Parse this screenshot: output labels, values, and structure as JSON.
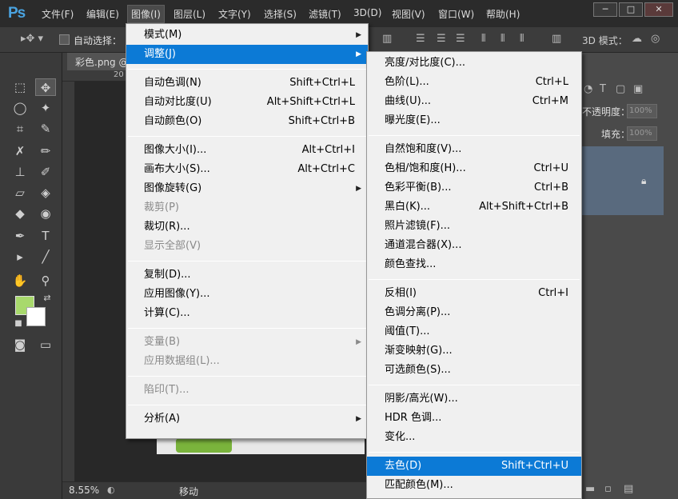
{
  "app": {
    "logo": "Ps"
  },
  "menubar": {
    "items": [
      "文件(F)",
      "编辑(E)",
      "图像(I)",
      "图层(L)",
      "文字(Y)",
      "选择(S)",
      "滤镜(T)",
      "3D(D)",
      "视图(V)",
      "窗口(W)",
      "帮助(H)"
    ],
    "active": "图像(I)"
  },
  "window_controls": {
    "minimize": "─",
    "restore": "□",
    "close": "✕"
  },
  "options_bar": {
    "auto_select_label": "自动选择：",
    "mode_3d_label": "3D 模式："
  },
  "document": {
    "tab_label": "彩色.png @",
    "ruler_top_label": "20",
    "ruler_left_labels": [
      "0",
      "2",
      "4",
      "6",
      "8",
      "1",
      "1",
      "1",
      "1",
      "1",
      "2"
    ],
    "zoom": "8.55%",
    "status": "移动"
  },
  "right_panel": {
    "opacity_label": "不透明度：",
    "opacity_value": "100%",
    "fill_label": "填充：",
    "fill_value": "100%"
  },
  "colors": {
    "foreground": "#a8d96c",
    "background": "#ffffff",
    "menu_highlight": "#0c7ad6"
  },
  "image_menu": {
    "items": [
      {
        "label": "模式(M)",
        "shortcut": "",
        "submenu": true,
        "disabled": false,
        "highlight": false
      },
      {
        "label": "调整(J)",
        "shortcut": "",
        "submenu": true,
        "disabled": false,
        "highlight": true
      },
      {
        "sep": true
      },
      {
        "label": "自动色调(N)",
        "shortcut": "Shift+Ctrl+L",
        "submenu": false,
        "disabled": false,
        "highlight": false
      },
      {
        "label": "自动对比度(U)",
        "shortcut": "Alt+Shift+Ctrl+L",
        "submenu": false,
        "disabled": false,
        "highlight": false
      },
      {
        "label": "自动颜色(O)",
        "shortcut": "Shift+Ctrl+B",
        "submenu": false,
        "disabled": false,
        "highlight": false
      },
      {
        "sep": true
      },
      {
        "label": "图像大小(I)...",
        "shortcut": "Alt+Ctrl+I",
        "submenu": false,
        "disabled": false,
        "highlight": false
      },
      {
        "label": "画布大小(S)...",
        "shortcut": "Alt+Ctrl+C",
        "submenu": false,
        "disabled": false,
        "highlight": false
      },
      {
        "label": "图像旋转(G)",
        "shortcut": "",
        "submenu": true,
        "disabled": false,
        "highlight": false
      },
      {
        "label": "裁剪(P)",
        "shortcut": "",
        "submenu": false,
        "disabled": true,
        "highlight": false
      },
      {
        "label": "裁切(R)...",
        "shortcut": "",
        "submenu": false,
        "disabled": false,
        "highlight": false
      },
      {
        "label": "显示全部(V)",
        "shortcut": "",
        "submenu": false,
        "disabled": true,
        "highlight": false
      },
      {
        "sep": true
      },
      {
        "label": "复制(D)...",
        "shortcut": "",
        "submenu": false,
        "disabled": false,
        "highlight": false
      },
      {
        "label": "应用图像(Y)...",
        "shortcut": "",
        "submenu": false,
        "disabled": false,
        "highlight": false
      },
      {
        "label": "计算(C)...",
        "shortcut": "",
        "submenu": false,
        "disabled": false,
        "highlight": false
      },
      {
        "sep": true
      },
      {
        "label": "变量(B)",
        "shortcut": "",
        "submenu": true,
        "disabled": true,
        "highlight": false
      },
      {
        "label": "应用数据组(L)...",
        "shortcut": "",
        "submenu": false,
        "disabled": true,
        "highlight": false
      },
      {
        "sep": true
      },
      {
        "label": "陷印(T)...",
        "shortcut": "",
        "submenu": false,
        "disabled": true,
        "highlight": false
      },
      {
        "sep": true
      },
      {
        "label": "分析(A)",
        "shortcut": "",
        "submenu": true,
        "disabled": false,
        "highlight": false
      }
    ]
  },
  "adjust_menu": {
    "items": [
      {
        "label": "亮度/对比度(C)...",
        "shortcut": "",
        "highlight": false
      },
      {
        "label": "色阶(L)...",
        "shortcut": "Ctrl+L",
        "highlight": false
      },
      {
        "label": "曲线(U)...",
        "shortcut": "Ctrl+M",
        "highlight": false
      },
      {
        "label": "曝光度(E)...",
        "shortcut": "",
        "highlight": false
      },
      {
        "sep": true
      },
      {
        "label": "自然饱和度(V)...",
        "shortcut": "",
        "highlight": false
      },
      {
        "label": "色相/饱和度(H)...",
        "shortcut": "Ctrl+U",
        "highlight": false
      },
      {
        "label": "色彩平衡(B)...",
        "shortcut": "Ctrl+B",
        "highlight": false
      },
      {
        "label": "黑白(K)...",
        "shortcut": "Alt+Shift+Ctrl+B",
        "highlight": false
      },
      {
        "label": "照片滤镜(F)...",
        "shortcut": "",
        "highlight": false
      },
      {
        "label": "通道混合器(X)...",
        "shortcut": "",
        "highlight": false
      },
      {
        "label": "颜色查找...",
        "shortcut": "",
        "highlight": false
      },
      {
        "sep": true
      },
      {
        "label": "反相(I)",
        "shortcut": "Ctrl+I",
        "highlight": false
      },
      {
        "label": "色调分离(P)...",
        "shortcut": "",
        "highlight": false
      },
      {
        "label": "阈值(T)...",
        "shortcut": "",
        "highlight": false
      },
      {
        "label": "渐变映射(G)...",
        "shortcut": "",
        "highlight": false
      },
      {
        "label": "可选颜色(S)...",
        "shortcut": "",
        "highlight": false
      },
      {
        "sep": true
      },
      {
        "label": "阴影/高光(W)...",
        "shortcut": "",
        "highlight": false
      },
      {
        "label": "HDR 色调...",
        "shortcut": "",
        "highlight": false
      },
      {
        "label": "变化...",
        "shortcut": "",
        "highlight": false
      },
      {
        "sep": true
      },
      {
        "label": "去色(D)",
        "shortcut": "Shift+Ctrl+U",
        "highlight": true
      },
      {
        "label": "匹配颜色(M)...",
        "shortcut": "",
        "highlight": false
      }
    ]
  }
}
